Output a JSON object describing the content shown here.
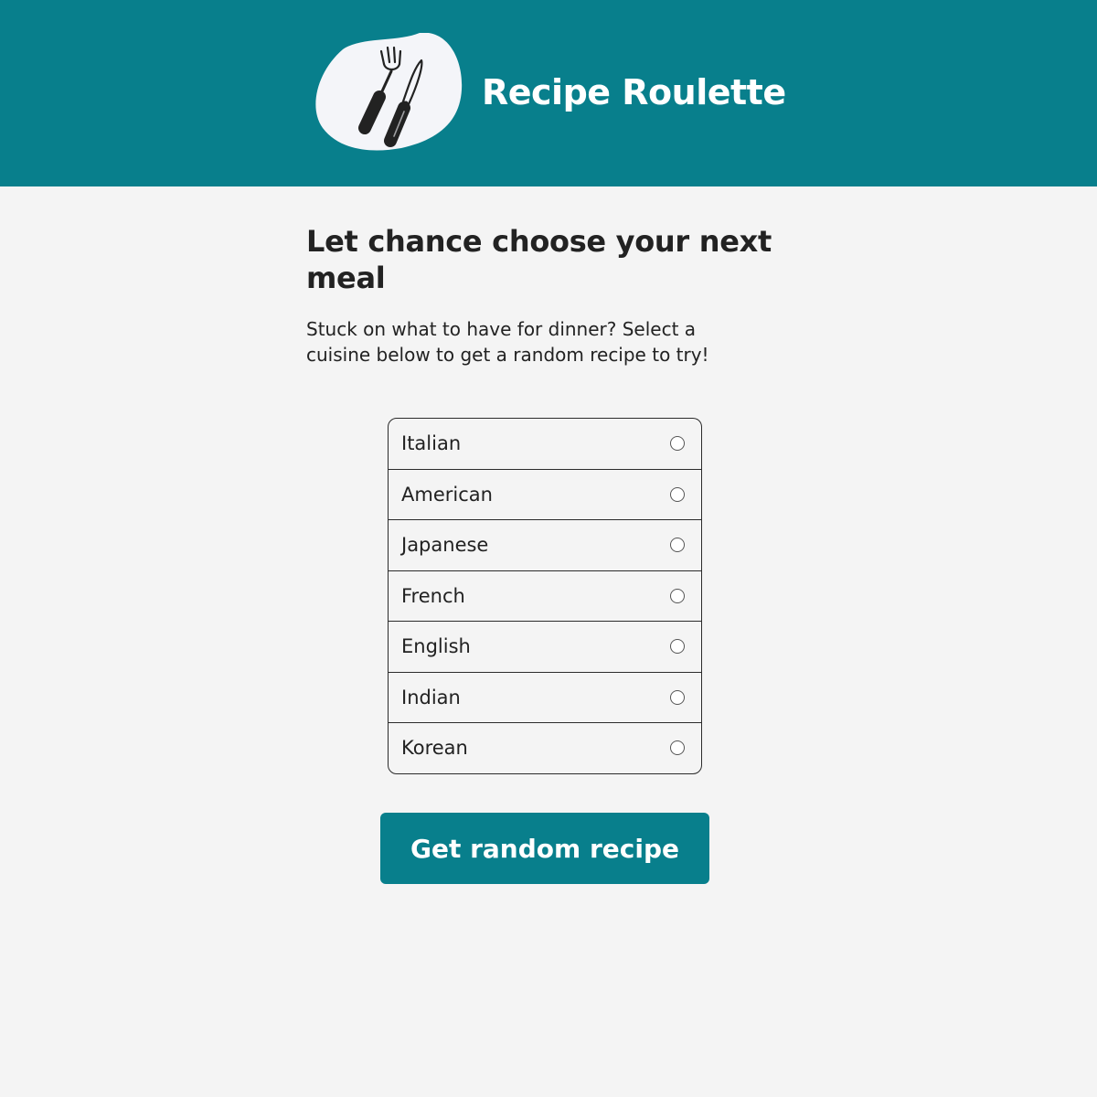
{
  "header": {
    "app_title": "Recipe Roulette",
    "logo_icon": "fork-knife-icon"
  },
  "main": {
    "heading": "Let chance choose your next meal",
    "intro": "Stuck on what to have for dinner? Select a cuisine below to get a random recipe to try!"
  },
  "cuisines": {
    "items": [
      {
        "label": "Italian",
        "selected": false
      },
      {
        "label": "American",
        "selected": false
      },
      {
        "label": "Japanese",
        "selected": false
      },
      {
        "label": "French",
        "selected": false
      },
      {
        "label": "English",
        "selected": false
      },
      {
        "label": "Indian",
        "selected": false
      },
      {
        "label": "Korean",
        "selected": false
      }
    ]
  },
  "actions": {
    "get_recipe_label": "Get random recipe"
  },
  "colors": {
    "brand": "#087f8c",
    "background": "#f4f4f4",
    "text": "#222222",
    "logo_blob": "#f4f5f9"
  }
}
